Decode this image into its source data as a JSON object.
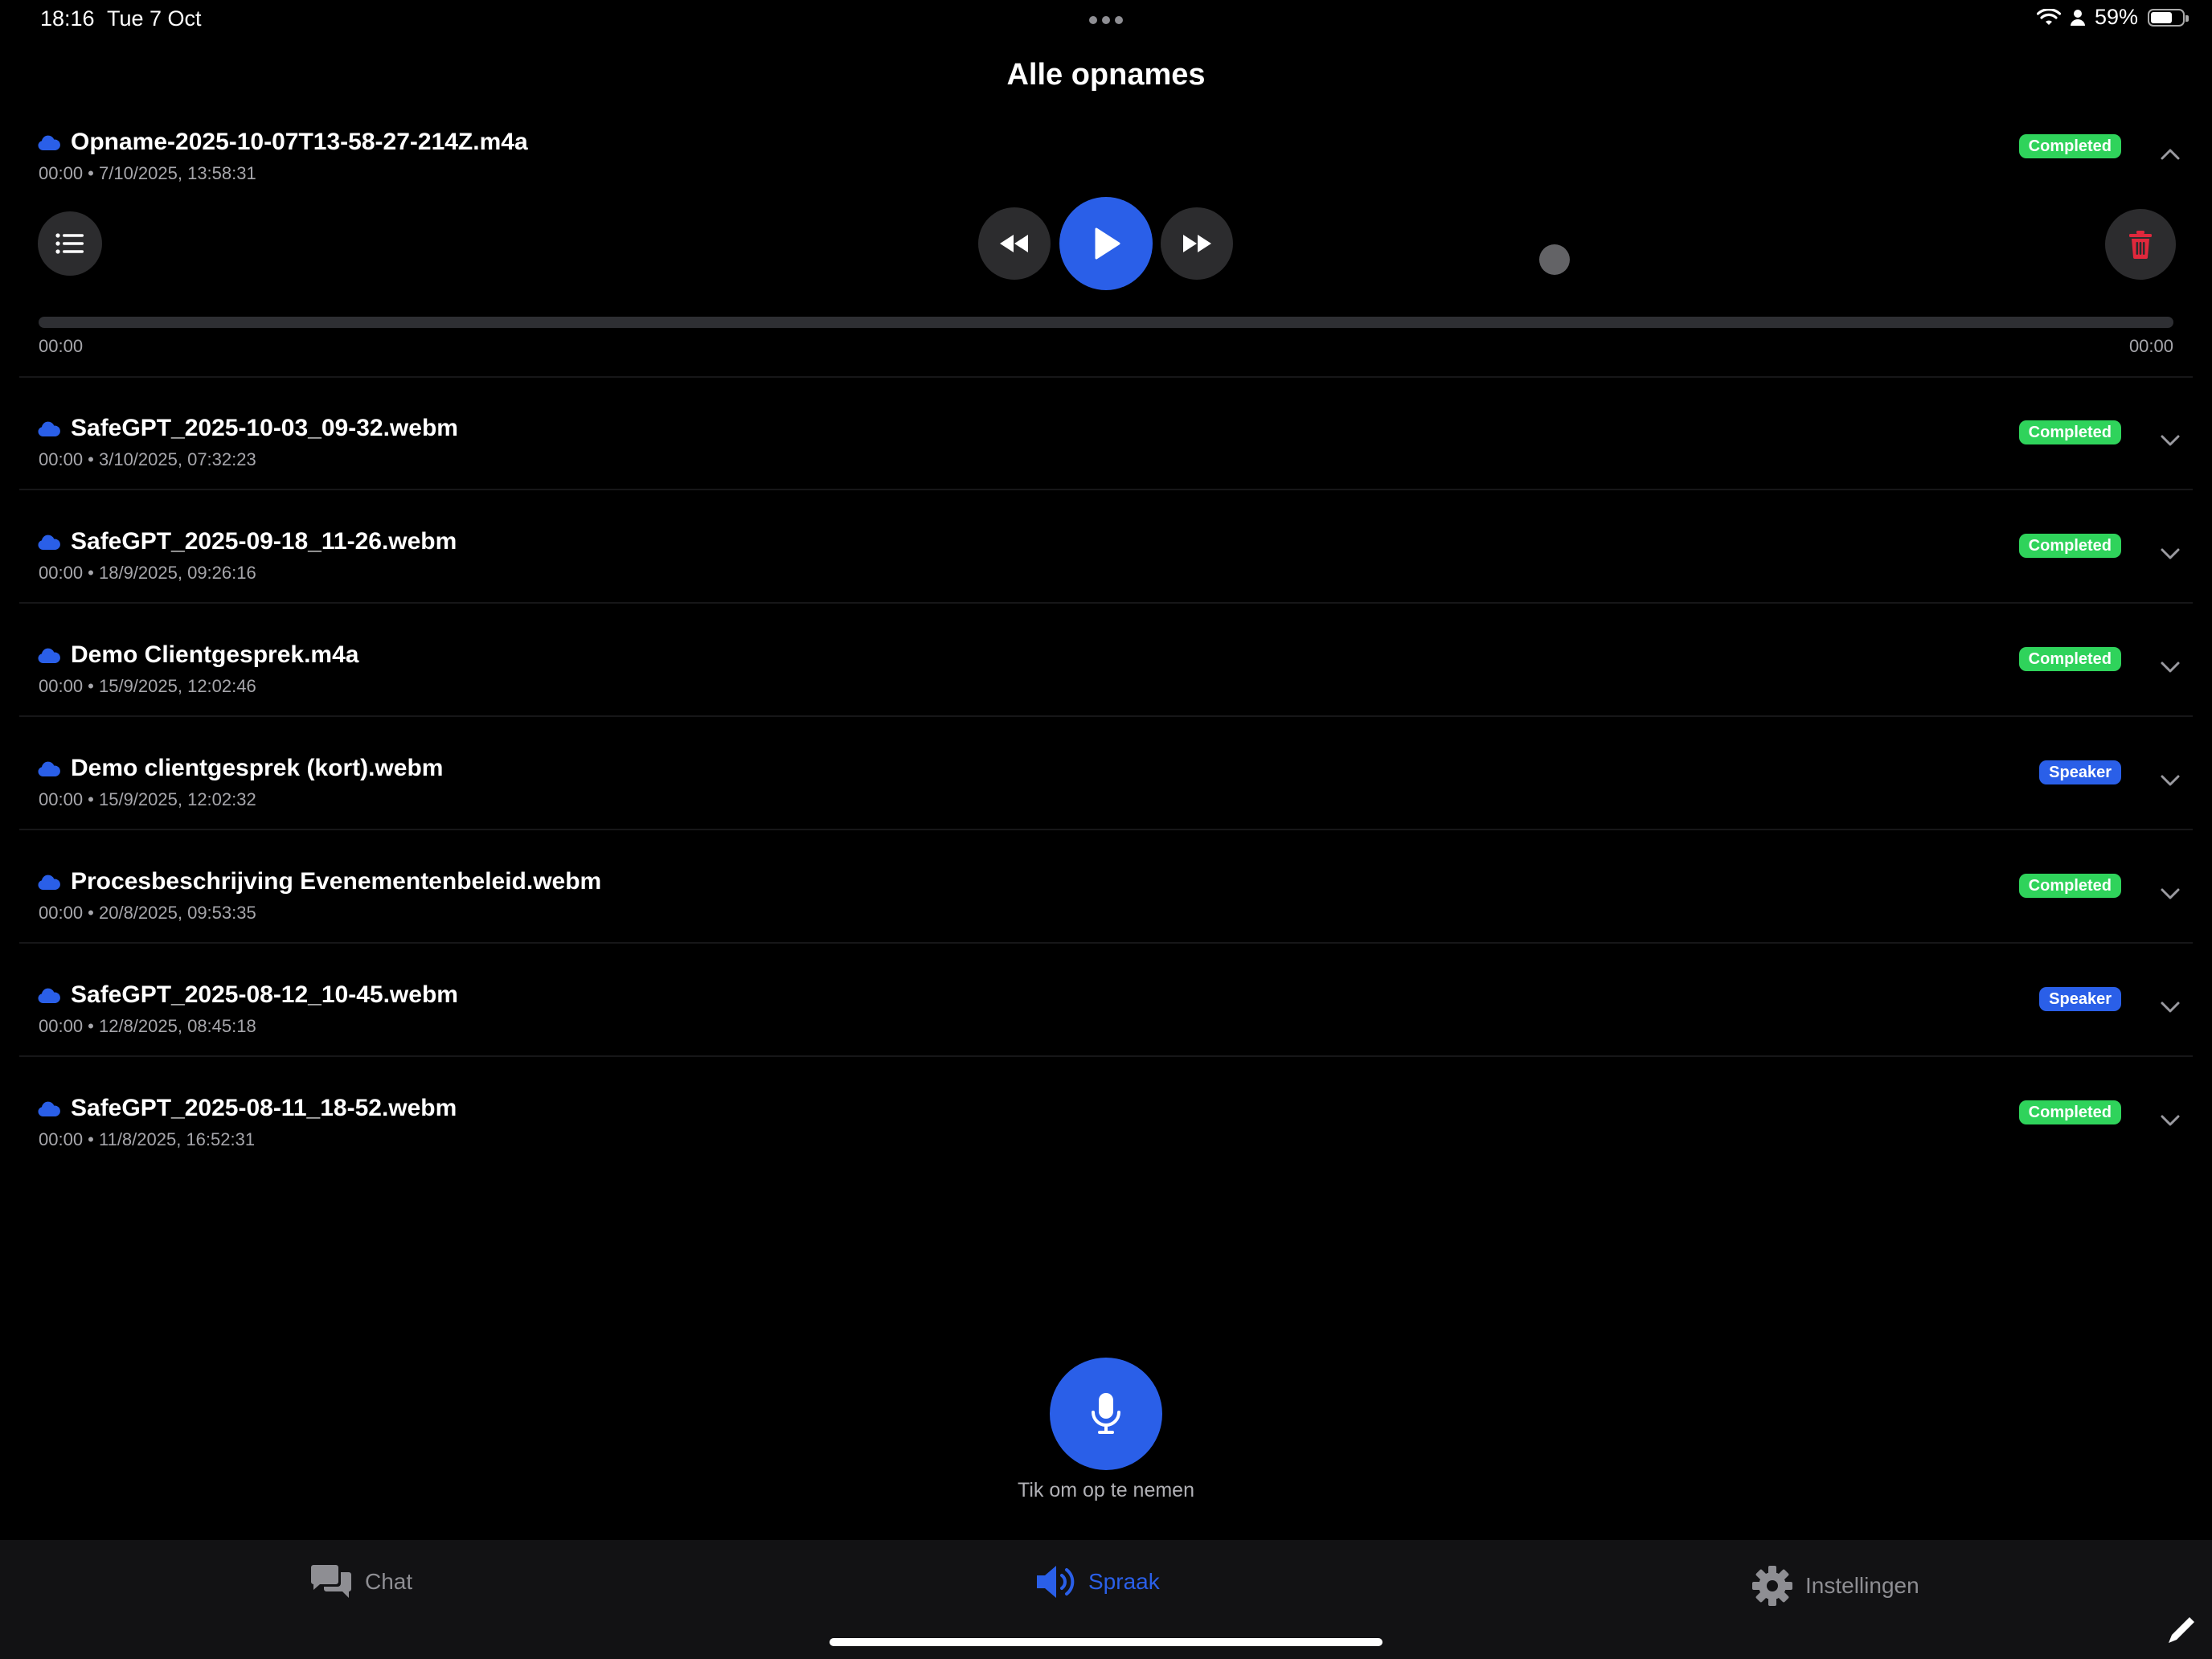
{
  "status_bar": {
    "time": "18:16",
    "date": "Tue 7 Oct",
    "battery": "59%"
  },
  "page_title": "Alle opnames",
  "player": {
    "elapsed": "00:00",
    "total": "00:00"
  },
  "recordings": [
    {
      "name": "Opname-2025-10-07T13-58-27-214Z.m4a",
      "meta": "00:00 • 7/10/2025, 13:58:31",
      "status": "Completed"
    },
    {
      "name": "SafeGPT_2025-10-03_09-32.webm",
      "meta": "00:00 • 3/10/2025, 07:32:23",
      "status": "Completed"
    },
    {
      "name": "SafeGPT_2025-09-18_11-26.webm",
      "meta": "00:00 • 18/9/2025, 09:26:16",
      "status": "Completed"
    },
    {
      "name": "Demo Clientgesprek.m4a",
      "meta": "00:00 • 15/9/2025, 12:02:46",
      "status": "Completed"
    },
    {
      "name": "Demo clientgesprek (kort).webm",
      "meta": "00:00 • 15/9/2025, 12:02:32",
      "status": "Speaker"
    },
    {
      "name": "Procesbeschrijving Evenementenbeleid.webm",
      "meta": "00:00 • 20/8/2025, 09:53:35",
      "status": "Completed"
    },
    {
      "name": "SafeGPT_2025-08-12_10-45.webm",
      "meta": "00:00 • 12/8/2025, 08:45:18",
      "status": "Speaker"
    },
    {
      "name": "SafeGPT_2025-08-11_18-52.webm",
      "meta": "00:00 • 11/8/2025, 16:52:31",
      "status": "Completed"
    }
  ],
  "record": {
    "hint": "Tik om op te nemen"
  },
  "tabs": {
    "chat": "Chat",
    "spraak": "Spraak",
    "instellingen": "Instellingen"
  },
  "colors": {
    "accent": "#2a5fe8",
    "completed": "#2fd35b",
    "delete": "#e0283c",
    "background": "#000000"
  },
  "icons": [
    "cloud-icon",
    "list-icon",
    "rewind-icon",
    "play-icon",
    "fast-forward-icon",
    "trash-icon",
    "chevron-up-icon",
    "chevron-down-icon",
    "microphone-icon",
    "chat-icon",
    "speaker-icon",
    "gear-icon",
    "wifi-icon",
    "person-icon",
    "battery-icon",
    "pencil-icon"
  ]
}
